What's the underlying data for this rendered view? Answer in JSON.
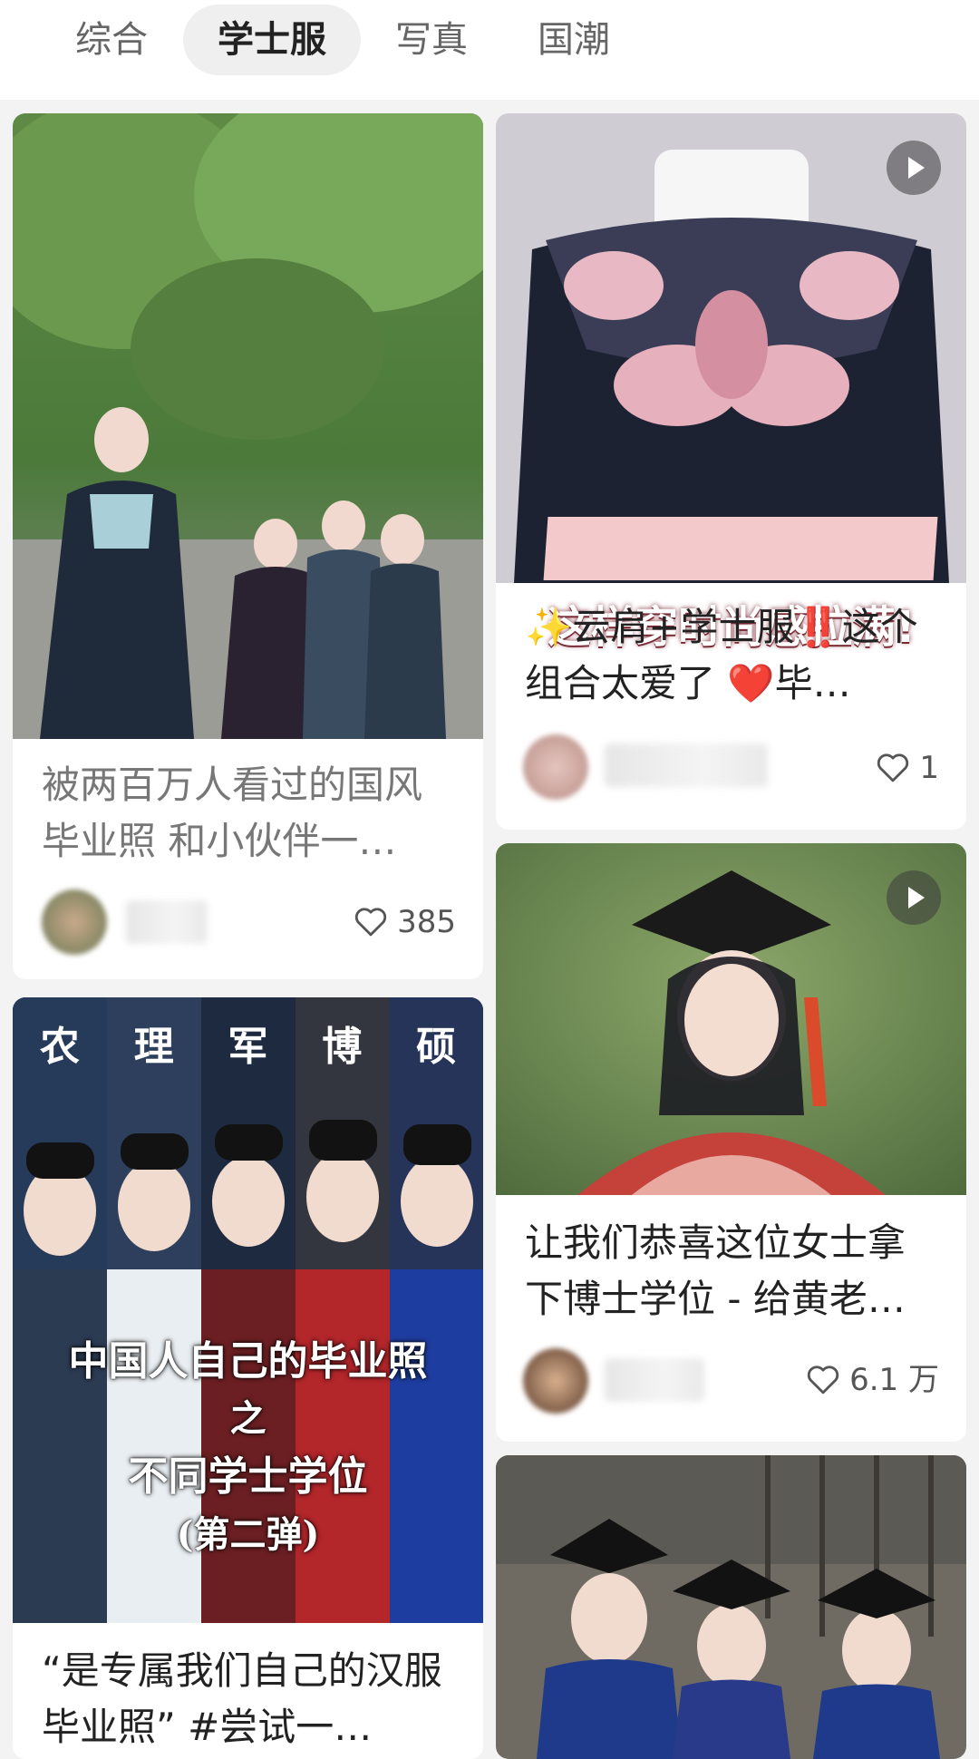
{
  "tabs": [
    {
      "label": "综合",
      "active": false
    },
    {
      "label": "学士服",
      "active": true
    },
    {
      "label": "写真",
      "active": false
    },
    {
      "label": "国潮",
      "active": false
    }
  ],
  "cards": {
    "c1": {
      "title": "被两百万人看过的国风毕业照 和小伙伴一…",
      "likes": "385",
      "is_video": false
    },
    "c2": {
      "title": "✨云肩+学士服‼️这个组合太爱了 ❤️毕…",
      "likes": "1",
      "is_video": true,
      "overlay_text": "这样穿时尚感拉满!"
    },
    "c3": {
      "title": "让我们恭喜这位女士拿下博士学位 - 给黄老…",
      "likes": "6.1 万",
      "is_video": true
    },
    "c4": {
      "title": "“是专属我们自己的汉服毕业照” #尝试一…",
      "poster_labels": [
        "农",
        "理",
        "军",
        "博",
        "硕"
      ],
      "poster_line1": "中国人自己的毕业照",
      "poster_line2": "之",
      "poster_line3": "不同学士学位",
      "poster_line4": "(第二弹)"
    },
    "c5": {
      "is_video": false
    }
  },
  "colors": {
    "tab_active_bg": "#efefef",
    "heart_outline": "#555555",
    "page_bg": "#f3f3f3"
  },
  "icons": {
    "like": "heart-outline-icon",
    "video": "play-icon"
  }
}
